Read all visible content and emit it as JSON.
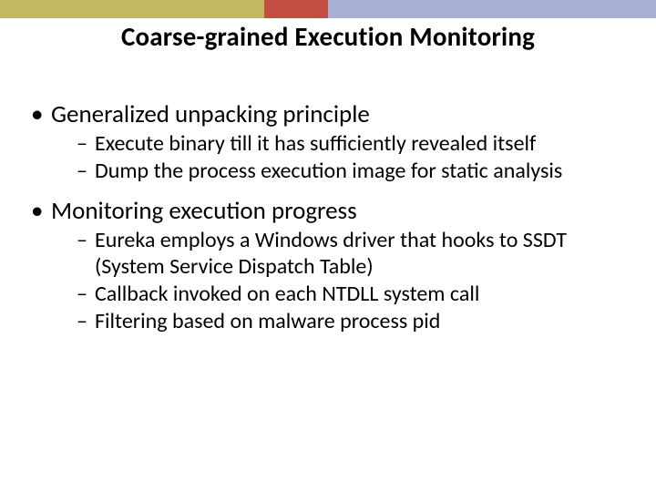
{
  "colors": {
    "olive": "#c3b760",
    "red": "#c34f44",
    "blue": "#a9aed4"
  },
  "title": "Coarse-grained Execution Monitoring",
  "b1": {
    "heading": "Generalized unpacking principle",
    "s1": "Execute binary till it has sufficiently revealed itself",
    "s2": "Dump the process execution image for static analysis"
  },
  "b2": {
    "heading": "Monitoring execution progress",
    "s1": "Eureka employs a Windows driver that hooks to SSDT (System Service Dispatch Table)",
    "s2": "Callback invoked on each NTDLL system call",
    "s3": "Filtering based on malware process pid"
  }
}
